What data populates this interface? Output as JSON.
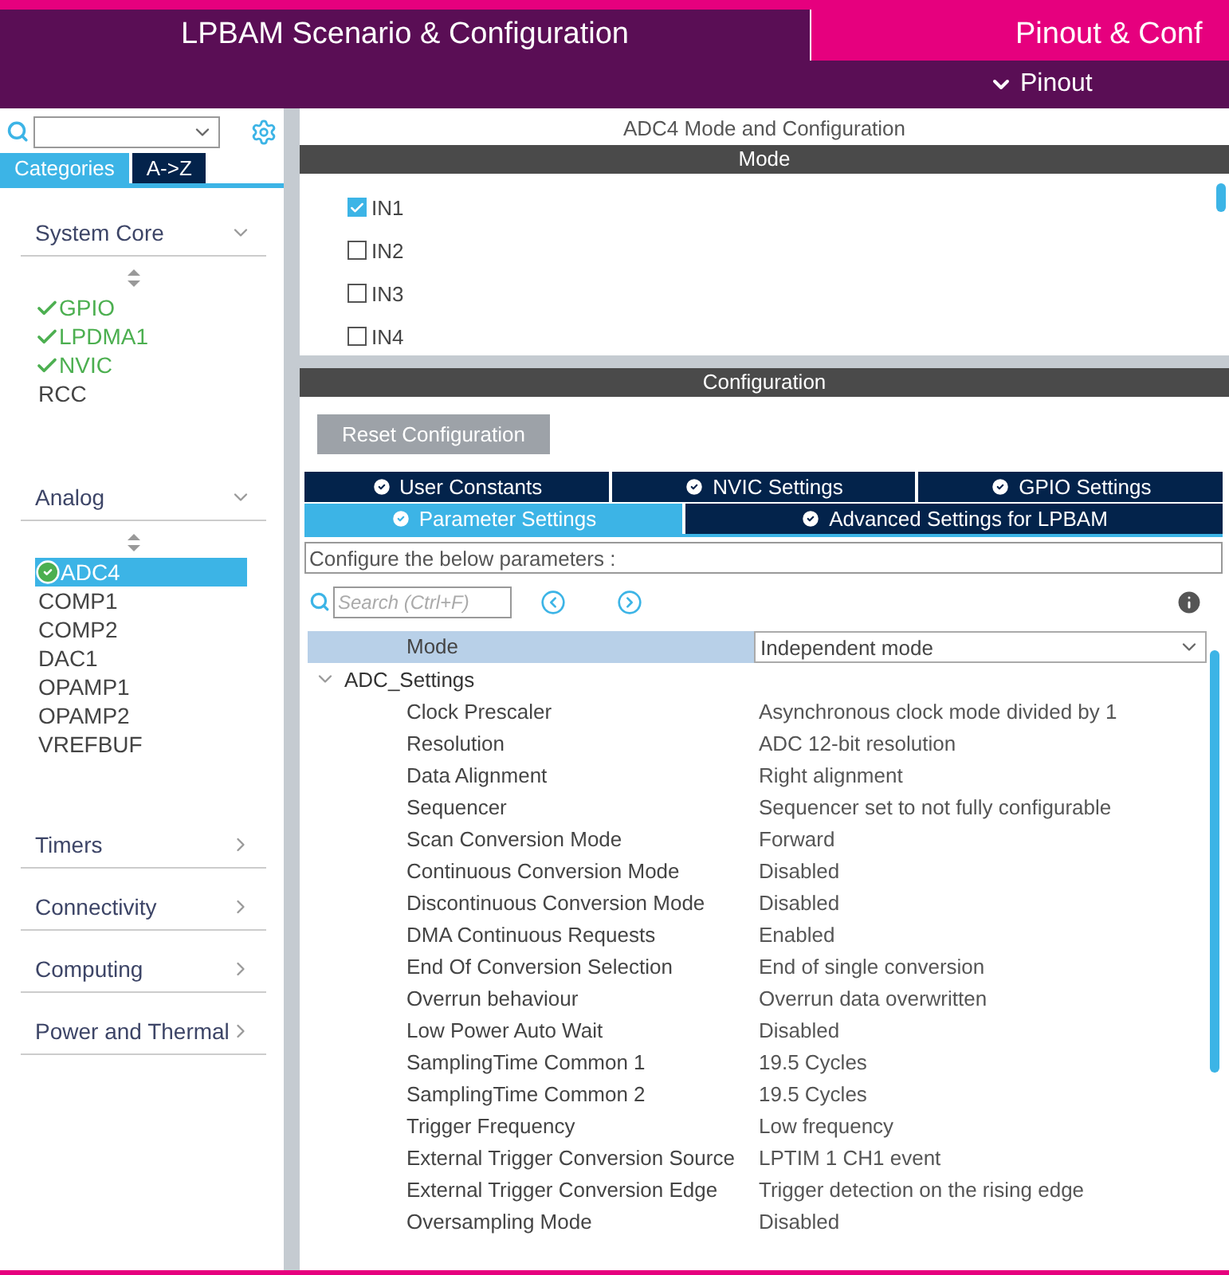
{
  "header": {
    "tabs": [
      {
        "label": "LPBAM Scenario & Configuration",
        "selected": true
      },
      {
        "label": "Pinout & Conf",
        "selected": false
      }
    ],
    "subtab": {
      "label": "Pinout",
      "expanded": true
    }
  },
  "sidebar": {
    "view_tabs": [
      {
        "label": "Categories",
        "selected": true
      },
      {
        "label": "A->Z",
        "selected": false
      }
    ],
    "categories": [
      {
        "label": "System Core",
        "expanded": true,
        "items": [
          {
            "label": "GPIO",
            "checked": true,
            "selected": false
          },
          {
            "label": "LPDMA1",
            "checked": true,
            "selected": false
          },
          {
            "label": "NVIC",
            "checked": true,
            "selected": false
          },
          {
            "label": "RCC",
            "checked": false,
            "selected": false
          }
        ]
      },
      {
        "label": "Analog",
        "expanded": true,
        "items": [
          {
            "label": "ADC4",
            "checked": true,
            "selected": true
          },
          {
            "label": "COMP1",
            "checked": false,
            "selected": false
          },
          {
            "label": "COMP2",
            "checked": false,
            "selected": false
          },
          {
            "label": "DAC1",
            "checked": false,
            "selected": false
          },
          {
            "label": "OPAMP1",
            "checked": false,
            "selected": false
          },
          {
            "label": "OPAMP2",
            "checked": false,
            "selected": false
          },
          {
            "label": "VREFBUF",
            "checked": false,
            "selected": false
          }
        ]
      },
      {
        "label": "Timers",
        "expanded": false
      },
      {
        "label": "Connectivity",
        "expanded": false
      },
      {
        "label": "Computing",
        "expanded": false
      },
      {
        "label": "Power and Thermal",
        "expanded": false
      }
    ]
  },
  "main": {
    "title": "ADC4 Mode and Configuration",
    "mode": {
      "heading": "Mode",
      "channels": [
        {
          "label": "IN1",
          "checked": true
        },
        {
          "label": "IN2",
          "checked": false
        },
        {
          "label": "IN3",
          "checked": false
        },
        {
          "label": "IN4",
          "checked": false
        }
      ]
    },
    "configuration": {
      "heading": "Configuration",
      "reset_button": "Reset Configuration",
      "tab_rows": [
        {
          "tabs": [
            {
              "label": "User Constants",
              "selected": false
            },
            {
              "label": "NVIC Settings",
              "selected": false
            },
            {
              "label": "GPIO Settings",
              "selected": false
            }
          ]
        },
        {
          "tabs": [
            {
              "label": "Parameter Settings",
              "selected": true
            },
            {
              "label": "Advanced Settings for LPBAM",
              "selected": false
            }
          ]
        }
      ],
      "hint": "Configure the below parameters :",
      "search": {
        "placeholder": "Search (Ctrl+F)"
      },
      "mode_row": {
        "label": "Mode",
        "value": "Independent mode"
      },
      "groups": [
        {
          "label": "ADC_Settings",
          "expanded": true,
          "children": [
            {
              "label": "Clock Prescaler",
              "value": "Asynchronous clock mode divided by 1"
            },
            {
              "label": "Resolution",
              "value": "ADC 12-bit resolution"
            },
            {
              "label": "Data Alignment",
              "value": "Right alignment"
            },
            {
              "label": "Sequencer",
              "value": "Sequencer set to not fully configurable"
            },
            {
              "label": "Scan Conversion Mode",
              "value": "Forward"
            },
            {
              "label": "Continuous Conversion Mode",
              "value": "Disabled"
            },
            {
              "label": "Discontinuous Conversion Mode",
              "value": "Disabled"
            },
            {
              "label": "DMA Continuous Requests",
              "value": "Enabled"
            },
            {
              "label": "End Of Conversion Selection",
              "value": "End of single conversion"
            },
            {
              "label": "Overrun behaviour",
              "value": "Overrun data overwritten"
            },
            {
              "label": "Low Power Auto Wait",
              "value": "Disabled"
            },
            {
              "label": "SamplingTime Common 1",
              "value": "19.5 Cycles"
            },
            {
              "label": "SamplingTime Common 2",
              "value": "19.5 Cycles"
            },
            {
              "label": "Trigger Frequency",
              "value": "Low frequency"
            },
            {
              "label": "External Trigger Conversion Source",
              "value": "LPTIM 1 CH1 event"
            },
            {
              "label": "External Trigger Conversion Edge",
              "value": "Trigger detection on the rising edge"
            },
            {
              "label": "Oversampling Mode",
              "value": "Disabled"
            }
          ]
        }
      ]
    }
  }
}
